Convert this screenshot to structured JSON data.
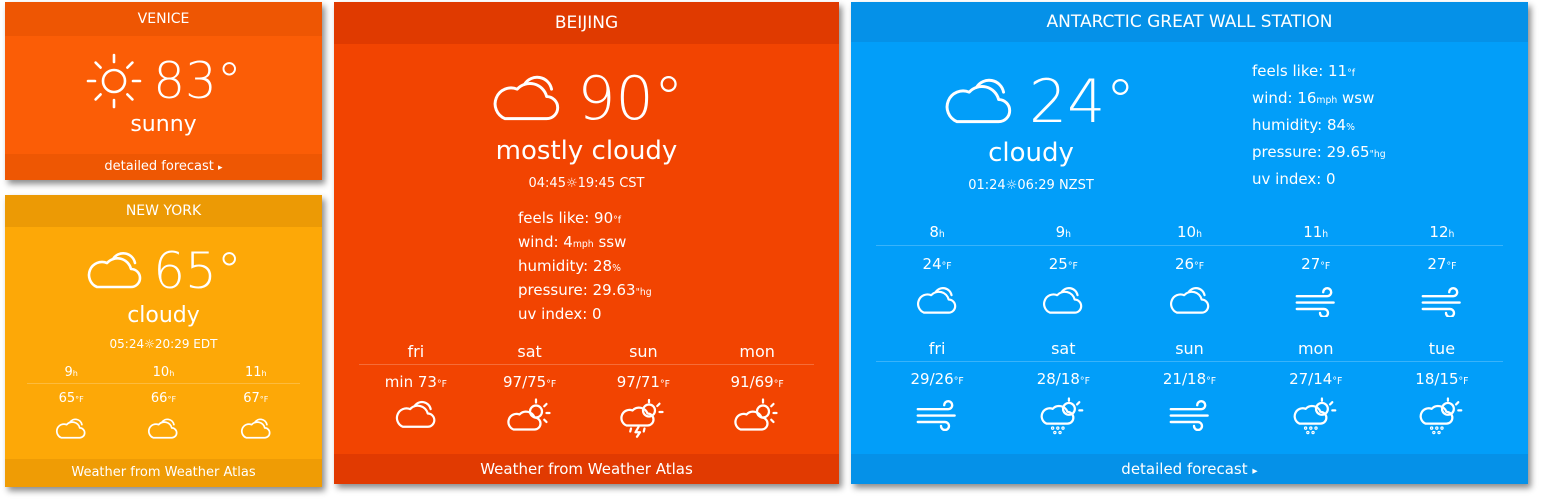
{
  "colors": {
    "venice_bg": "#fb5d06",
    "venice_hdr": "#ee5603",
    "venice_ftr": "#ee5703",
    "newyork_bg": "#fda807",
    "newyork_hdr": "#ec9a05",
    "newyork_ftr": "#ef9c05",
    "beijing_bg": "#f24401",
    "beijing_hdr": "#e03a00",
    "beijing_ftr": "#e13a01",
    "antarctic_bg": "#029ef9",
    "antarctic_hdr": "#0591e8",
    "antarctic_ftr": "#0591e8"
  },
  "venice": {
    "city": "VENICE",
    "temp": "83°",
    "condition": "sunny",
    "icon": "sun-icon",
    "footer": "detailed forecast"
  },
  "newyork": {
    "city": "NEW YORK",
    "temp": "65°",
    "condition": "cloudy",
    "icon": "cloud-icon",
    "sunrise": "05:24",
    "sunset": "20:29 EDT",
    "hourly": [
      {
        "hour": "9",
        "unit": "h",
        "temp": "65",
        "tunit": "°F",
        "icon": "cloud-icon"
      },
      {
        "hour": "10",
        "unit": "h",
        "temp": "66",
        "tunit": "°F",
        "icon": "cloud-icon"
      },
      {
        "hour": "11",
        "unit": "h",
        "temp": "67",
        "tunit": "°F",
        "icon": "cloud-icon"
      }
    ],
    "footer": "Weather from Weather Atlas"
  },
  "beijing": {
    "city": "BEIJING",
    "temp": "90°",
    "condition": "mostly cloudy",
    "icon": "cloud-icon",
    "sunrise": "04:45",
    "sunset": "19:45 CST",
    "details": {
      "feels_label": "feels like: ",
      "feels_val": "90",
      "feels_unit": "°f",
      "wind_label": "wind: ",
      "wind_val": "4",
      "wind_unit": "mph",
      "wind_dir": " ssw",
      "humidity_label": "humidity: ",
      "humidity_val": "28",
      "humidity_unit": "%",
      "pressure_label": "pressure: ",
      "pressure_val": "29.63",
      "pressure_unit": "\"hg",
      "uv_label": "uv index: ",
      "uv_val": "0"
    },
    "daily": [
      {
        "day": "fri",
        "temp": "min 73",
        "tunit": "°F",
        "icon": "cloud-icon"
      },
      {
        "day": "sat",
        "temp": "97/75",
        "tunit": "°F",
        "icon": "partly-sunny-icon"
      },
      {
        "day": "sun",
        "temp": "97/71",
        "tunit": "°F",
        "icon": "thunderstorm-icon"
      },
      {
        "day": "mon",
        "temp": "91/69",
        "tunit": "°F",
        "icon": "partly-sunny-icon"
      }
    ],
    "footer": "Weather from Weather Atlas"
  },
  "antarctic": {
    "city": "ANTARCTIC GREAT WALL STATION",
    "temp": "24°",
    "condition": "cloudy",
    "icon": "cloud-icon",
    "sunrise": "01:24",
    "sunset": "06:29 NZST",
    "details": {
      "feels_label": "feels like: ",
      "feels_val": "11",
      "feels_unit": "°f",
      "wind_label": "wind: ",
      "wind_val": "16",
      "wind_unit": "mph",
      "wind_dir": " wsw",
      "humidity_label": "humidity: ",
      "humidity_val": "84",
      "humidity_unit": "%",
      "pressure_label": "pressure: ",
      "pressure_val": "29.65",
      "pressure_unit": "\"hg",
      "uv_label": "uv index: ",
      "uv_val": "0"
    },
    "hourly": [
      {
        "hour": "8",
        "unit": "h",
        "temp": "24",
        "tunit": "°F",
        "icon": "cloud-icon"
      },
      {
        "hour": "9",
        "unit": "h",
        "temp": "25",
        "tunit": "°F",
        "icon": "cloud-icon"
      },
      {
        "hour": "10",
        "unit": "h",
        "temp": "26",
        "tunit": "°F",
        "icon": "cloud-icon"
      },
      {
        "hour": "11",
        "unit": "h",
        "temp": "27",
        "tunit": "°F",
        "icon": "wind-icon"
      },
      {
        "hour": "12",
        "unit": "h",
        "temp": "27",
        "tunit": "°F",
        "icon": "wind-icon"
      }
    ],
    "daily": [
      {
        "day": "fri",
        "temp": "29/26",
        "tunit": "°F",
        "icon": "wind-icon"
      },
      {
        "day": "sat",
        "temp": "28/18",
        "tunit": "°F",
        "icon": "partly-sunny-snow-icon"
      },
      {
        "day": "sun",
        "temp": "21/18",
        "tunit": "°F",
        "icon": "wind-icon"
      },
      {
        "day": "mon",
        "temp": "27/14",
        "tunit": "°F",
        "icon": "partly-sunny-snow-icon"
      },
      {
        "day": "tue",
        "temp": "18/15",
        "tunit": "°F",
        "icon": "partly-sunny-snow-icon"
      }
    ],
    "footer": "detailed forecast"
  }
}
